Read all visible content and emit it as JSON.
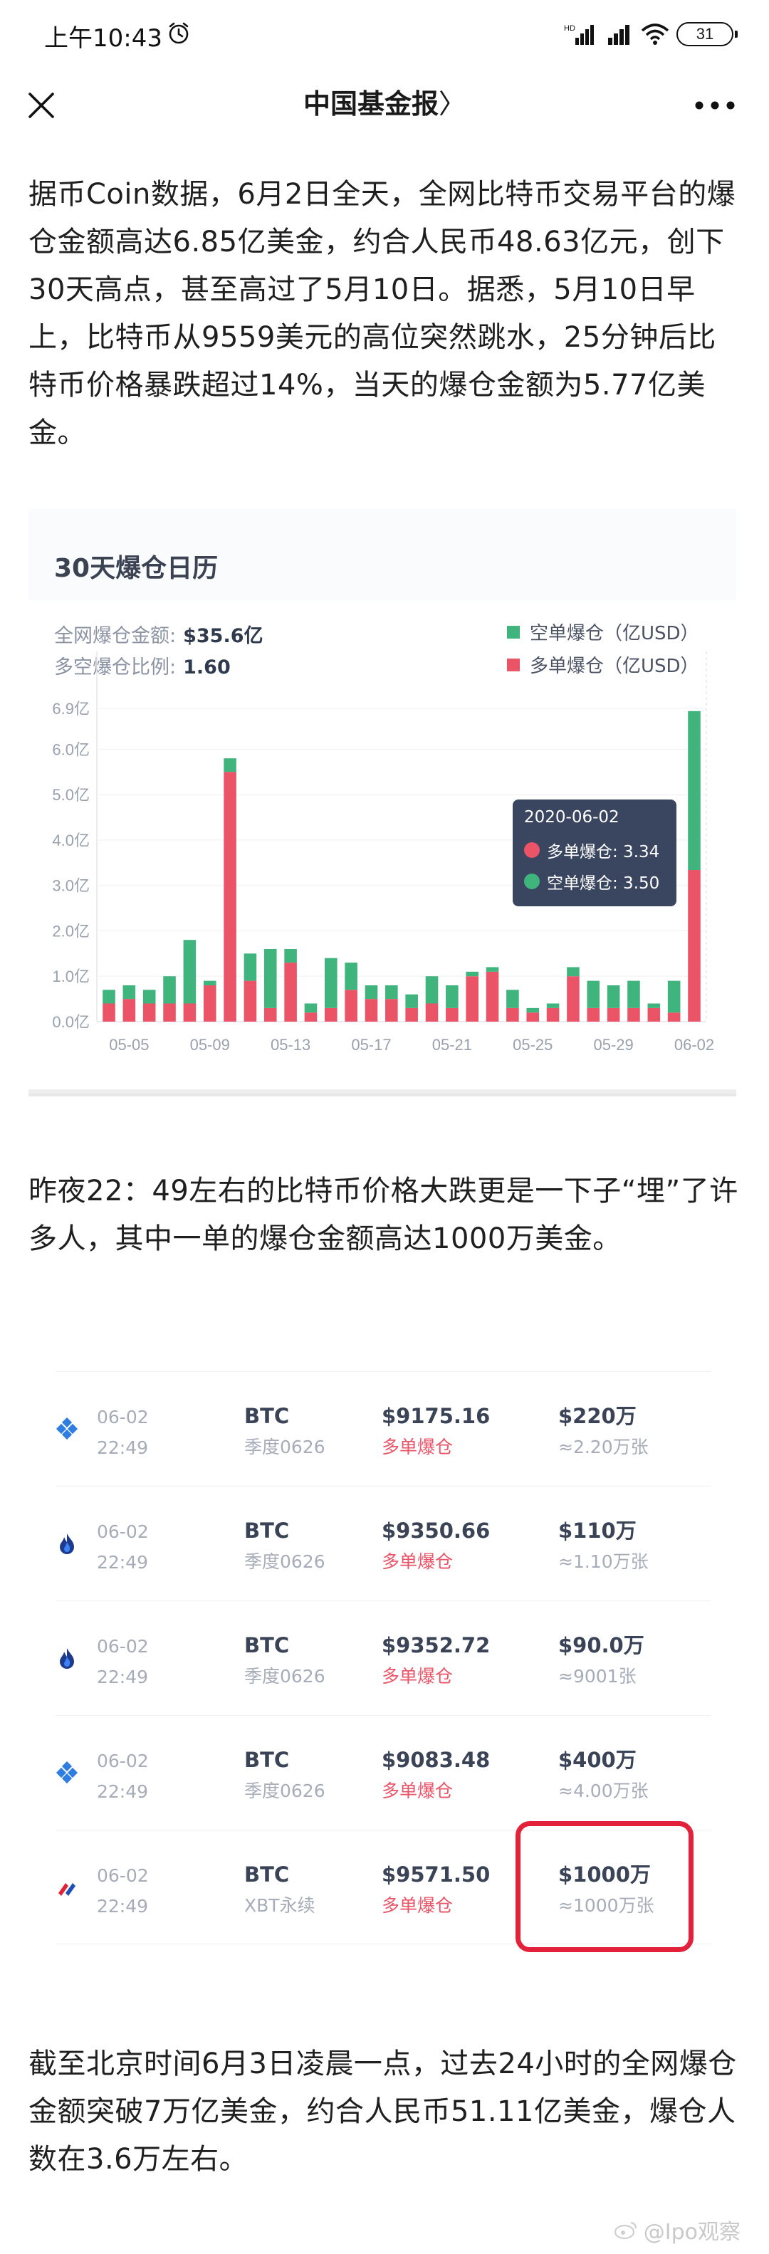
{
  "status_bar": {
    "time": "上午10:43",
    "network": "HD",
    "battery": "31"
  },
  "nav": {
    "title": "中国基金报",
    "title_suffix": "〉"
  },
  "article": {
    "para1": "据币Coin数据，6月2日全天，全网比特币交易平台的爆仓金额高达6.85亿美金，约合人民币48.63亿元，创下30天高点，甚至高过了5月10日。据悉，5月10日早上，比特币从9559美元的高位突然跳水，25分钟后比特币价格暴跌超过14%，当天的爆仓金额为5.77亿美金。",
    "para2": "昨夜22：49左右的比特币价格大跌更是一下子“埋”了许多人，其中一单的爆仓金额高达1000万美金。",
    "para3": "截至北京时间6月3日凌晨一点，过去24小时的全网爆仓金额突破7万亿美金，约合人民币51.11亿美金，爆仓人数在3.6万左右。"
  },
  "chart_card": {
    "title": "30天爆仓日历",
    "total_label": "全网爆仓金额:",
    "total_value": "$35.6亿",
    "ratio_label": "多空爆仓比例:",
    "ratio_value": "1.60",
    "legend_short": "空单爆仓（亿USD）",
    "legend_long": "多单爆仓（亿USD）",
    "colors": {
      "short": "#3fb47c",
      "long": "#ea5466",
      "tooltip_bg": "#3a4660"
    },
    "tooltip": {
      "date": "2020-06-02",
      "long_label": "多单爆仓: 3.34",
      "short_label": "空单爆仓: 3.50"
    }
  },
  "chart_data": {
    "type": "bar",
    "stacked": true,
    "title": "30天爆仓日历",
    "y_ticks": [
      "0.0亿",
      "1.0亿",
      "2.0亿",
      "3.0亿",
      "4.0亿",
      "5.0亿",
      "6.0亿",
      "6.9亿"
    ],
    "ylim": [
      0,
      6.9
    ],
    "x_ticks": [
      "05-05",
      "05-09",
      "05-13",
      "05-17",
      "05-21",
      "05-25",
      "05-29",
      "06-02"
    ],
    "categories": [
      "05-04",
      "05-05",
      "05-06",
      "05-07",
      "05-08",
      "05-09",
      "05-10",
      "05-11",
      "05-12",
      "05-13",
      "05-14",
      "05-15",
      "05-16",
      "05-17",
      "05-18",
      "05-19",
      "05-20",
      "05-21",
      "05-22",
      "05-23",
      "05-24",
      "05-25",
      "05-26",
      "05-27",
      "05-28",
      "05-29",
      "05-30",
      "05-31",
      "06-01",
      "06-02"
    ],
    "series": [
      {
        "name": "多单爆仓（亿USD）",
        "values": [
          0.4,
          0.5,
          0.4,
          0.4,
          0.4,
          0.8,
          5.5,
          0.9,
          0.3,
          1.3,
          0.2,
          0.3,
          0.7,
          0.5,
          0.5,
          0.3,
          0.4,
          0.3,
          1.0,
          1.1,
          0.3,
          0.2,
          0.3,
          1.0,
          0.3,
          0.3,
          0.3,
          0.3,
          0.2,
          3.34
        ]
      },
      {
        "name": "空单爆仓（亿USD）",
        "values": [
          0.3,
          0.3,
          0.3,
          0.6,
          1.4,
          0.1,
          0.3,
          0.6,
          1.3,
          0.3,
          0.2,
          1.1,
          0.6,
          0.3,
          0.3,
          0.3,
          0.6,
          0.5,
          0.1,
          0.1,
          0.4,
          0.1,
          0.1,
          0.2,
          0.6,
          0.5,
          0.6,
          0.1,
          0.7,
          3.5
        ]
      }
    ]
  },
  "liquidations": [
    {
      "icon": "exchange-icon-blue-diamond",
      "date": "06-02",
      "time": "22:49",
      "symbol": "BTC",
      "contract": "季度0626",
      "price": "$9175.16",
      "side": "多单爆仓",
      "amount": "$220万",
      "qty": "≈2.20万张"
    },
    {
      "icon": "exchange-icon-blue-flame",
      "date": "06-02",
      "time": "22:49",
      "symbol": "BTC",
      "contract": "季度0626",
      "price": "$9350.66",
      "side": "多单爆仓",
      "amount": "$110万",
      "qty": "≈1.10万张"
    },
    {
      "icon": "exchange-icon-blue-flame",
      "date": "06-02",
      "time": "22:49",
      "symbol": "BTC",
      "contract": "季度0626",
      "price": "$9352.72",
      "side": "多单爆仓",
      "amount": "$90.0万",
      "qty": "≈9001张"
    },
    {
      "icon": "exchange-icon-blue-diamond",
      "date": "06-02",
      "time": "22:49",
      "symbol": "BTC",
      "contract": "季度0626",
      "price": "$9083.48",
      "side": "多单爆仓",
      "amount": "$400万",
      "qty": "≈4.00万张"
    },
    {
      "icon": "exchange-icon-bitmex",
      "date": "06-02",
      "time": "22:49",
      "symbol": "BTC",
      "contract": "XBT永续",
      "price": "$9571.50",
      "side": "多单爆仓",
      "amount": "$1000万",
      "qty": "≈1000万张"
    }
  ],
  "watermark": "@Ipo观察"
}
